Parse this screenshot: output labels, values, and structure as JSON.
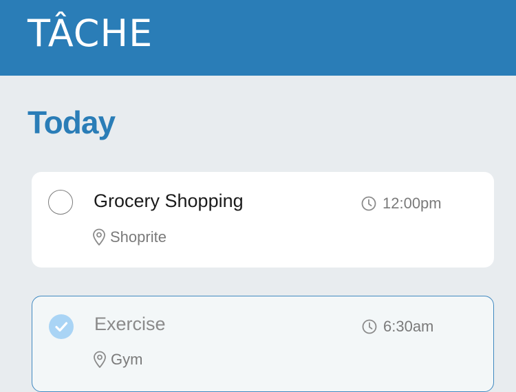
{
  "header": {
    "brand": "TÂCHE",
    "color": "#2a7db7"
  },
  "section": {
    "title": "Today"
  },
  "tasks": [
    {
      "title": "Grocery Shopping",
      "time": "12:00pm",
      "location": "Shoprite",
      "completed": false
    },
    {
      "title": "Exercise",
      "time": "6:30am",
      "location": "Gym",
      "completed": true
    }
  ],
  "icons": {
    "time": "clock-icon",
    "location": "map-pin-icon",
    "completed": "checkmark-icon"
  }
}
